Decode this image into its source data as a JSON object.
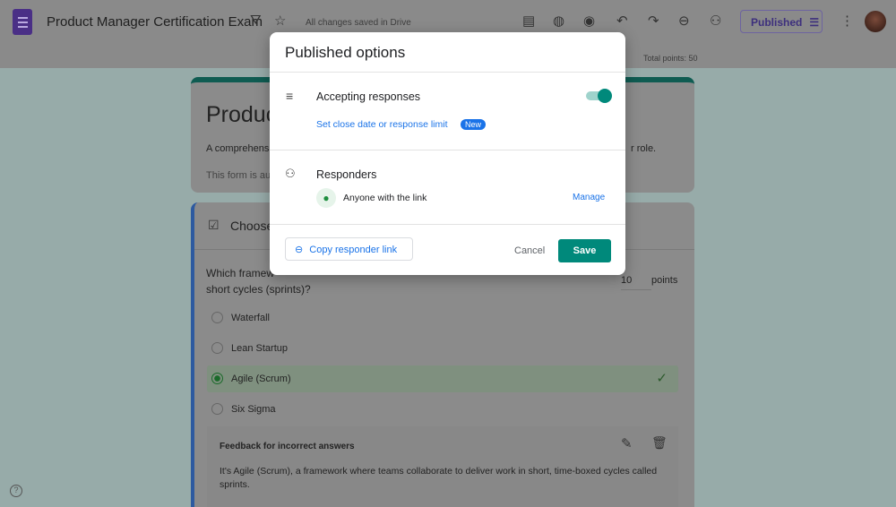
{
  "header": {
    "title": "Product Manager Certification Exam",
    "save_status": "All changes saved in Drive",
    "published_label": "Published",
    "total_points": "Total points: 50"
  },
  "form": {
    "title_visible": "Produc",
    "description_left": "A comprehens",
    "description_right": "r role.",
    "note_visible": "This form is au"
  },
  "question": {
    "type_label_visible": "Choose",
    "text_line1_visible": "Which framew",
    "text_line2": "short cycles (sprints)?",
    "points_value": "10",
    "points_label": "points",
    "options": [
      {
        "label": "Waterfall",
        "selected": false
      },
      {
        "label": "Lean Startup",
        "selected": false
      },
      {
        "label": "Agile (Scrum)",
        "selected": true,
        "correct": true
      },
      {
        "label": "Six Sigma",
        "selected": false
      }
    ],
    "feedback_title": "Feedback for incorrect answers",
    "feedback_text": "It's Agile (Scrum), a framework where teams collaborate to deliver work in short, time-boxed cycles called sprints."
  },
  "modal": {
    "title": "Published options",
    "accepting_label": "Accepting responses",
    "accepting_on": true,
    "close_date_link": "Set close date or response limit",
    "new_badge": "New",
    "responders_label": "Responders",
    "access": "Anyone with the link",
    "manage": "Manage",
    "copy_link": "Copy responder link",
    "cancel": "Cancel",
    "save": "Save"
  },
  "colors": {
    "accent": "#00897b",
    "link": "#1a73e8",
    "brand": "#673ab7"
  }
}
